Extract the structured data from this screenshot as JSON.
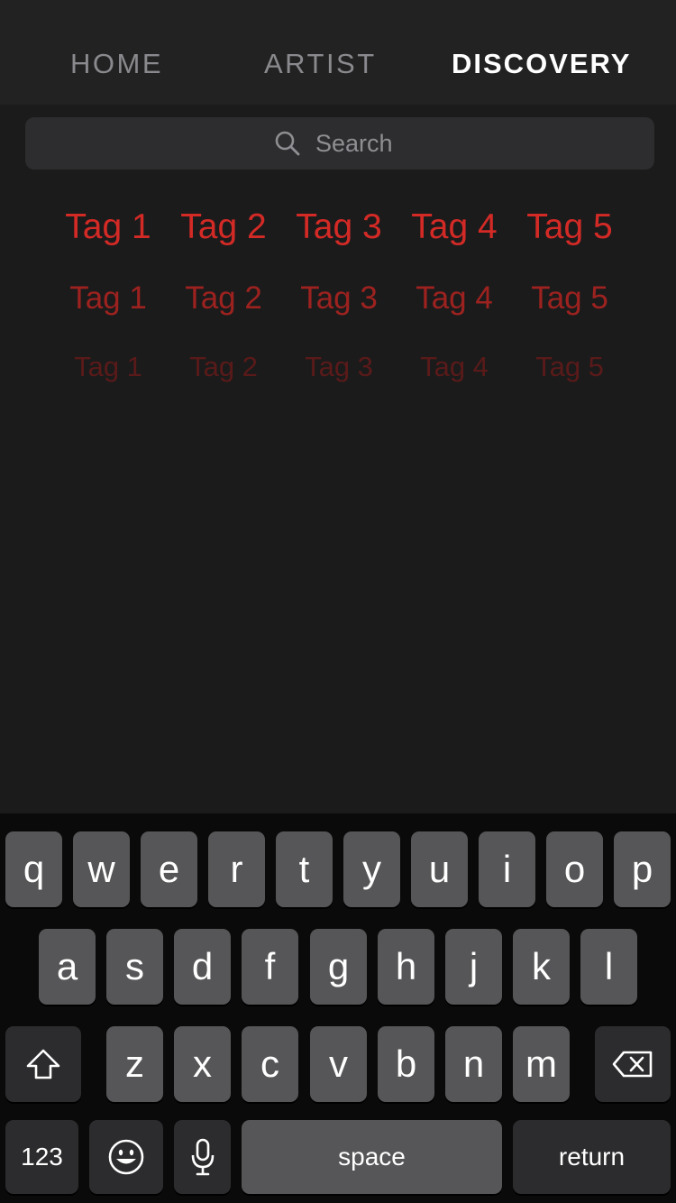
{
  "nav": {
    "tabs": [
      {
        "label": "HOME",
        "active": false
      },
      {
        "label": "ARTIST",
        "active": false
      },
      {
        "label": "DISCOVERY",
        "active": true
      }
    ]
  },
  "search": {
    "placeholder": "Search",
    "value": ""
  },
  "tags": {
    "row1": [
      "Tag 1",
      "Tag 2",
      "Tag 3",
      "Tag 4",
      "Tag 5"
    ],
    "row2": [
      "Tag 1",
      "Tag 2",
      "Tag 3",
      "Tag 4",
      "Tag 5"
    ],
    "row3": [
      "Tag 1",
      "Tag 2",
      "Tag 3",
      "Tag 4",
      "Tag 5"
    ]
  },
  "keyboard": {
    "row1": [
      "q",
      "w",
      "e",
      "r",
      "t",
      "y",
      "u",
      "i",
      "o",
      "p"
    ],
    "row2": [
      "a",
      "s",
      "d",
      "f",
      "g",
      "h",
      "j",
      "k",
      "l"
    ],
    "row3": [
      "z",
      "x",
      "c",
      "v",
      "b",
      "n",
      "m"
    ],
    "numbers_label": "123",
    "space_label": "space",
    "return_label": "return",
    "icons": {
      "shift": "shift-icon",
      "delete": "delete-icon",
      "emoji": "emoji-icon",
      "mic": "microphone-icon"
    }
  },
  "colors": {
    "accent": "#d42a26",
    "background": "#1b1b1c",
    "key": "#565658"
  }
}
